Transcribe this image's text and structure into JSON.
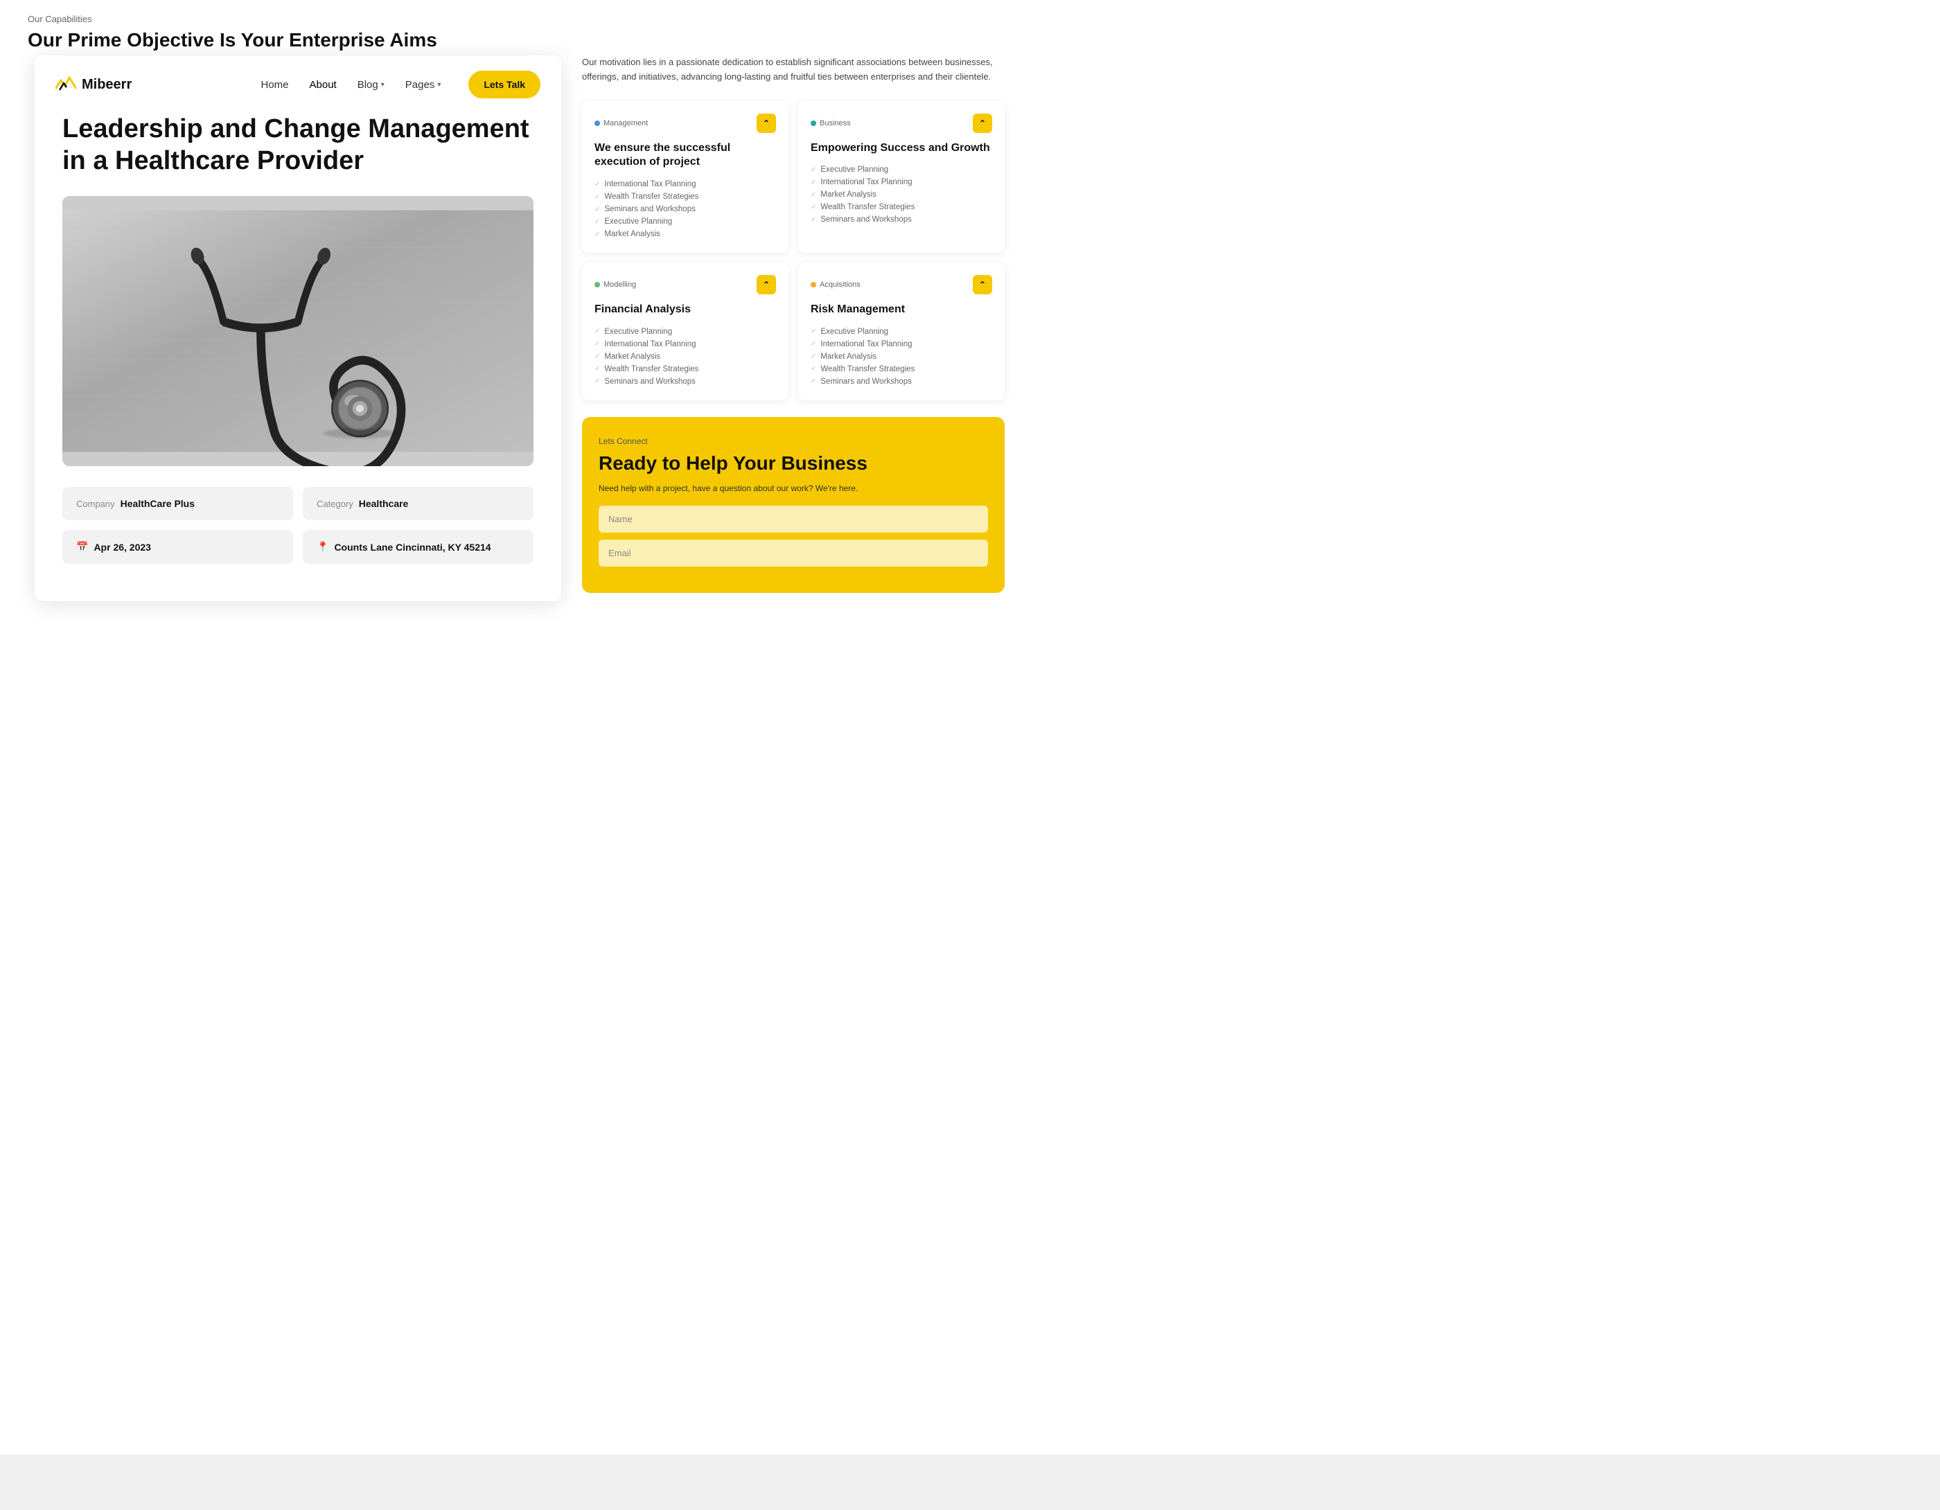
{
  "bgSection": {
    "capabilitiesLabel": "Our Capabilities",
    "capabilitiesTitle": "Our Prime Objective Is Your Enterprise Aims"
  },
  "navbar": {
    "logoText": "Mibeerr",
    "links": [
      {
        "label": "Home",
        "hasDropdown": false
      },
      {
        "label": "About",
        "hasDropdown": false
      },
      {
        "label": "Blog",
        "hasDropdown": true
      },
      {
        "label": "Pages",
        "hasDropdown": true
      }
    ],
    "ctaLabel": "Lets Talk"
  },
  "post": {
    "title": "Leadership and Change Management in a Healthcare Provider",
    "metaCompanyLabel": "Company",
    "metaCompanyValue": "HealthCare Plus",
    "metaCategoryLabel": "Category",
    "metaCategoryValue": "Healthcare",
    "metaDate": "Apr 26, 2023",
    "metaLocation": "Counts Lane Cincinnati, KY 45214"
  },
  "rightPanel": {
    "motivationText": "Our motivation lies in a passionate dedication to establish significant associations between businesses, offerings, and initiatives, advancing long-lasting and fruitful ties between enterprises and their clientele.",
    "capabilities": [
      {
        "tag": "Management",
        "tagColor": "blue",
        "title": "We ensure the successful execution of project",
        "items": [
          "International Tax Planning",
          "Wealth Transfer Strategies",
          "Seminars and Workshops",
          "Executive Planning",
          "Market Analysis"
        ]
      },
      {
        "tag": "Business",
        "tagColor": "teal",
        "title": "Empowering Success and Growth",
        "items": [
          "Executive Planning",
          "International Tax Planning",
          "Market Analysis",
          "Wealth Transfer Strategies",
          "Seminars and Workshops"
        ]
      },
      {
        "tag": "Modelling",
        "tagColor": "green",
        "title": "Financial Analysis",
        "items": [
          "Executive Planning",
          "International Tax Planning",
          "Market Analysis",
          "Wealth Transfer Strategies",
          "Seminars and Workshops"
        ]
      },
      {
        "tag": "Acquisitions",
        "tagColor": "orange",
        "title": "Risk Management",
        "items": [
          "Executive Planning",
          "International Tax Planning",
          "Market Analysis",
          "Wealth Transfer Strategies",
          "Seminars and Workshops"
        ]
      }
    ],
    "cta": {
      "letsConnect": "Lets Connect",
      "title": "Ready to Help Your Business",
      "description": "Need help with a project, have a question about our work? We're here.",
      "namePlaceholder": "Name",
      "emailPlaceholder": "Email"
    }
  }
}
